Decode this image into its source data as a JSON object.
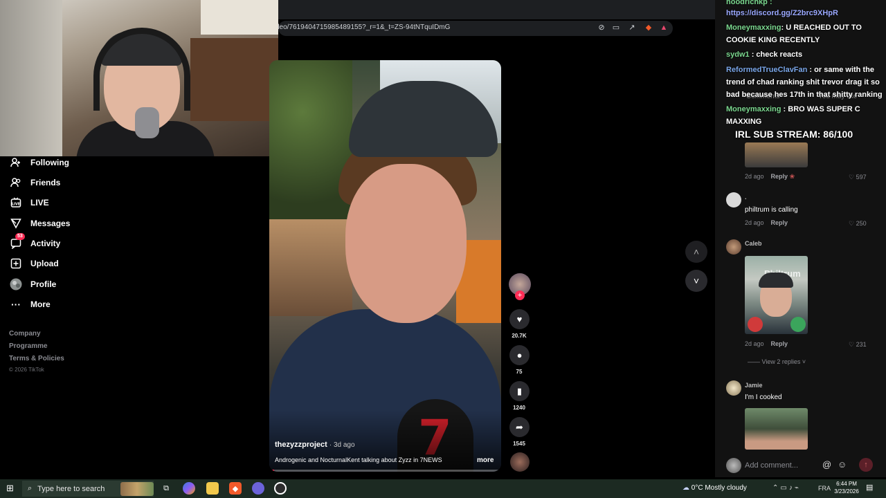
{
  "browser": {
    "url": "deo/7619404715985489155?_r=1&_t=ZS-94tNTquIDmG",
    "minimize": "−",
    "restore": "❐",
    "close": "✕"
  },
  "nav": {
    "items": [
      {
        "label": "Following"
      },
      {
        "label": "Friends"
      },
      {
        "label": "LIVE"
      },
      {
        "label": "Messages"
      },
      {
        "label": "Activity",
        "badge": "53"
      },
      {
        "label": "Upload"
      },
      {
        "label": "Profile"
      },
      {
        "label": "More"
      }
    ],
    "footer": [
      "Company",
      "Programme",
      "Terms & Policies"
    ],
    "copyright": "© 2026 TikTok"
  },
  "video": {
    "author": "thezyzzproject",
    "ago": "· 3d ago",
    "description": "Androgenic and NocturnalKent talking about Zyzz in 7NEWS",
    "more": "more",
    "progress": 0.02,
    "likes": "20.7K",
    "comments": "75",
    "saves": "1240",
    "shares": "1545",
    "mic_text": "7"
  },
  "chat": {
    "line1_user": "hoodrichkp :",
    "line1_link": "https://discord.gg/Z2brc9XHpR",
    "line2_user": "Moneymaxxing",
    "line2_text": ": U REACHED OUT TO COOKIE KING RECENTLY",
    "line3_user": "sydw1",
    "line3_text": " : check reacts",
    "line4_user": "ReformedTrueClavFan",
    "line4_text": " : or same with the trend of chad ranking shit trevor drag it so bad because hes 17th in that shitty ranking",
    "line5_user": "Moneymaxxing",
    "line5_text": " : BRO WAS SUPER C MAXXING",
    "sub_goal": "IRL SUB STREAM: 86/100"
  },
  "comments_panel": {
    "tab_comments": "Comments",
    "tab_you_may_like": "You may like",
    "comments": [
      {
        "user": "",
        "text": "",
        "time": "2d ago",
        "reply": "Reply",
        "likes": "597"
      },
      {
        "user": ".",
        "text": "philtrum is calling",
        "time": "2d ago",
        "reply": "Reply",
        "likes": "250"
      },
      {
        "user": "Caleb",
        "text": "",
        "time": "2d ago",
        "reply": "Reply",
        "likes": "231",
        "image_caption": "Philtrum"
      },
      {
        "user": "Jamie",
        "text": "I'm I cooked"
      }
    ],
    "view_replies": "View 2 replies",
    "add_placeholder": "Add comment...",
    "at": "@",
    "emoji": "☺",
    "send": "↑"
  },
  "taskbar": {
    "search_placeholder": "Type here to search",
    "weather": "0°C  Mostly cloudy",
    "lang": "FRA",
    "time": "6:44 PM",
    "date": "3/23/2026"
  }
}
